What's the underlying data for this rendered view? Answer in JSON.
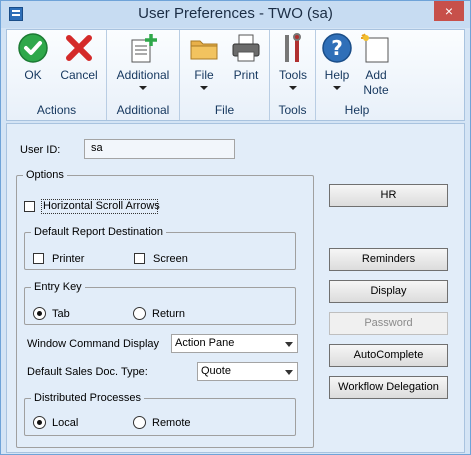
{
  "window": {
    "title": "User Preferences  -  TWO (sa)",
    "close_glyph": "×"
  },
  "ribbon": {
    "groups": [
      {
        "label": "Actions",
        "buttons": [
          {
            "label": "OK",
            "icon": "check-icon"
          },
          {
            "label": "Cancel",
            "icon": "x-icon"
          }
        ]
      },
      {
        "label": "Additional",
        "buttons": [
          {
            "label": "Additional",
            "icon": "additional-icon"
          }
        ]
      },
      {
        "label": "File",
        "buttons": [
          {
            "label": "File",
            "icon": "folder-icon"
          },
          {
            "label": "Print",
            "icon": "printer-icon"
          }
        ]
      },
      {
        "label": "Tools",
        "buttons": [
          {
            "label": "Tools",
            "icon": "tools-icon"
          }
        ]
      },
      {
        "label": "Help",
        "buttons": [
          {
            "label": "Help",
            "icon": "help-icon"
          },
          {
            "label": "Add",
            "label2": "Note",
            "icon": "note-icon"
          }
        ]
      }
    ]
  },
  "form": {
    "user_id_label": "User ID:",
    "user_id_value": "sa",
    "options_label": "Options",
    "horizontal_scroll_label": "Horizontal Scroll Arrows",
    "horizontal_scroll_checked": false,
    "report_dest_label": "Default Report Destination",
    "printer_label": "Printer",
    "screen_label": "Screen",
    "entry_key_label": "Entry Key",
    "tab_label": "Tab",
    "return_label": "Return",
    "entry_key_selected": "Tab",
    "window_cmd_label": "Window Command Display",
    "window_cmd_value": "Action Pane",
    "sales_doc_label": "Default Sales Doc. Type:",
    "sales_doc_value": "Quote",
    "dist_proc_label": "Distributed Processes",
    "local_label": "Local",
    "remote_label": "Remote",
    "dist_proc_selected": "Local"
  },
  "side_buttons": {
    "hr": "HR",
    "reminders": "Reminders",
    "display": "Display",
    "password": "Password",
    "autocomplete": "AutoComplete",
    "workflow": "Workflow Delegation"
  },
  "colors": {
    "accent": "#2f6fb8",
    "ribbon_text": "#15375e",
    "close": "#c7504a"
  }
}
